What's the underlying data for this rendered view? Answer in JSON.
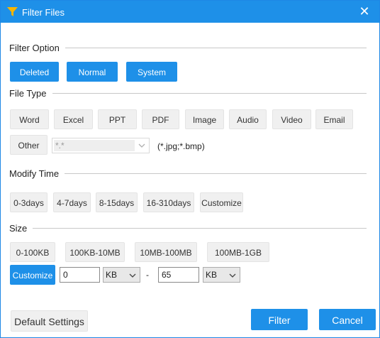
{
  "window": {
    "title": "Filter Files",
    "close_glyph": "✕",
    "icon": "funnel-icon"
  },
  "filter_option": {
    "label": "Filter Option",
    "buttons": [
      "Deleted",
      "Normal",
      "System"
    ]
  },
  "file_type": {
    "label": "File Type",
    "buttons": [
      "Word",
      "Excel",
      "PPT",
      "PDF",
      "Image",
      "Audio",
      "Video",
      "Email"
    ],
    "other_label": "Other",
    "pattern_value": "*.*",
    "hint": "(*.jpg;*.bmp)"
  },
  "modify_time": {
    "label": "Modify Time",
    "buttons": [
      "0-3days",
      "4-7days",
      "8-15days",
      "16-310days",
      "Customize"
    ]
  },
  "size": {
    "label": "Size",
    "buttons": [
      "0-100KB",
      "100KB-10MB",
      "10MB-100MB",
      "100MB-1GB"
    ],
    "customize_label": "Customize",
    "min_value": "0",
    "min_unit": "KB",
    "separator": "-",
    "max_value": "65",
    "max_unit": "KB"
  },
  "footer": {
    "default_label": "Default Settings",
    "filter_label": "Filter",
    "cancel_label": "Cancel"
  },
  "colors": {
    "accent": "#1e90e8",
    "button_gray": "#f0f0f0"
  }
}
